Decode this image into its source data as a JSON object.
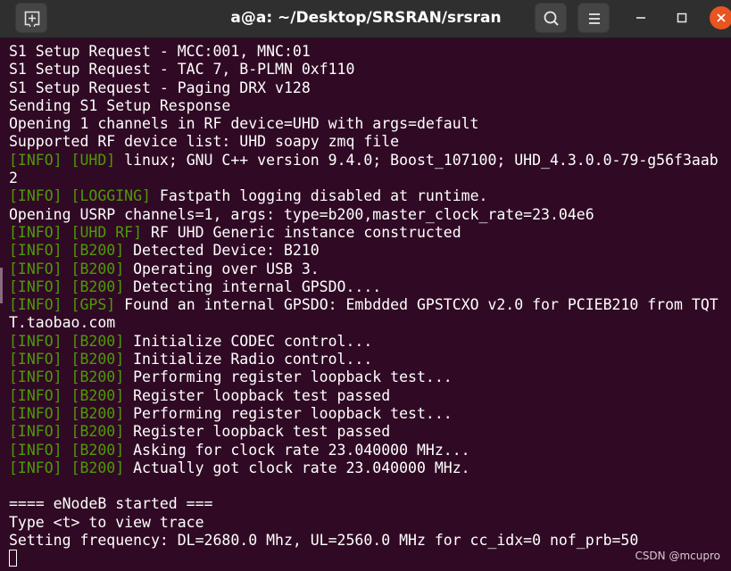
{
  "window": {
    "title": "a@a: ~/Desktop/SRSRAN/srsran",
    "icons": {
      "new_tab": "new-tab-icon",
      "search": "search-icon",
      "menu": "hamburger-menu-icon",
      "minimize": "minimize-icon",
      "maximize": "maximize-icon",
      "close": "close-icon"
    },
    "colors": {
      "terminal_bg": "#300a24",
      "titlebar_bg": "#2f2f2f",
      "tag_green": "#4e9a06",
      "close_orange": "#e95420"
    }
  },
  "terminal": {
    "lines": [
      {
        "text": "S1 Setup Request - MCC:001, MNC:01"
      },
      {
        "text": "S1 Setup Request - TAC 7, B-PLMN 0xf110"
      },
      {
        "text": "S1 Setup Request - Paging DRX v128"
      },
      {
        "text": "Sending S1 Setup Response"
      },
      {
        "text": "Opening 1 channels in RF device=UHD with args=default"
      },
      {
        "text": "Supported RF device list: UHD soapy zmq file"
      },
      {
        "tag": "[INFO] [UHD]",
        "text": " linux; GNU C++ version 9.4.0; Boost_107100; UHD_4.3.0.0-79-g56f3aab"
      },
      {
        "text": "2"
      },
      {
        "tag": "[INFO] [LOGGING]",
        "text": " Fastpath logging disabled at runtime."
      },
      {
        "text": "Opening USRP channels=1, args: type=b200,master_clock_rate=23.04e6"
      },
      {
        "tag": "[INFO] [UHD RF]",
        "text": " RF UHD Generic instance constructed"
      },
      {
        "tag": "[INFO] [B200]",
        "text": " Detected Device: B210"
      },
      {
        "tag": "[INFO] [B200]",
        "text": " Operating over USB 3."
      },
      {
        "tag": "[INFO] [B200]",
        "text": " Detecting internal GPSDO...."
      },
      {
        "tag": "[INFO] [GPS]",
        "text": " Found an internal GPSDO: Embdded GPSTCXO v2.0 for PCIEB210 from TQT"
      },
      {
        "text": "T.taobao.com"
      },
      {
        "tag": "[INFO] [B200]",
        "text": " Initialize CODEC control..."
      },
      {
        "tag": "[INFO] [B200]",
        "text": " Initialize Radio control..."
      },
      {
        "tag": "[INFO] [B200]",
        "text": " Performing register loopback test..."
      },
      {
        "tag": "[INFO] [B200]",
        "text": " Register loopback test passed"
      },
      {
        "tag": "[INFO] [B200]",
        "text": " Performing register loopback test..."
      },
      {
        "tag": "[INFO] [B200]",
        "text": " Register loopback test passed"
      },
      {
        "tag": "[INFO] [B200]",
        "text": " Asking for clock rate 23.040000 MHz..."
      },
      {
        "tag": "[INFO] [B200]",
        "text": " Actually got clock rate 23.040000 MHz."
      },
      {
        "text": ""
      },
      {
        "text": "==== eNodeB started ==="
      },
      {
        "text": "Type <t> to view trace"
      },
      {
        "text": "Setting frequency: DL=2680.0 Mhz, UL=2560.0 MHz for cc_idx=0 nof_prb=50"
      }
    ]
  },
  "watermark": "CSDN @mcupro"
}
